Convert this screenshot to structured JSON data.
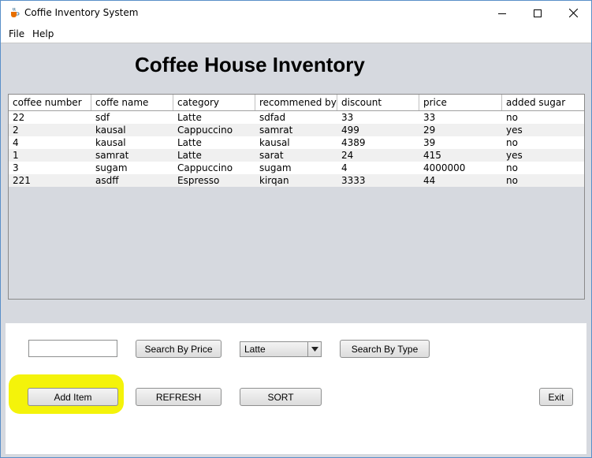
{
  "window": {
    "title": "Coffie Inventory System",
    "controls": [
      "minimize-icon",
      "maximize-icon",
      "close-icon"
    ],
    "icon": "java-cup-icon"
  },
  "menu": {
    "items": [
      {
        "label": "File"
      },
      {
        "label": "Help"
      }
    ]
  },
  "heading": "Coffee House Inventory",
  "table": {
    "columns": [
      "coffee number",
      "coffe name",
      "category",
      "recommened by",
      "discount",
      "price",
      "added sugar"
    ],
    "rows": [
      [
        "22",
        "sdf",
        "Latte",
        "sdfad",
        "33",
        "33",
        "no"
      ],
      [
        "2",
        "kausal",
        "Cappuccino",
        "samrat",
        "499",
        "29",
        "yes"
      ],
      [
        "4",
        "kausal",
        "Latte",
        "kausal",
        "4389",
        "39",
        "no"
      ],
      [
        "1",
        "samrat",
        "Latte",
        "sarat",
        "24",
        "415",
        "yes"
      ],
      [
        "3",
        "sugam",
        "Cappuccino",
        "sugam",
        "4",
        "4000000",
        "no"
      ],
      [
        "221",
        "asdff",
        "Espresso",
        "kirqan",
        "3333",
        "44",
        "no"
      ]
    ]
  },
  "controls": {
    "search_value": "",
    "search_by_price_label": "Search By Price",
    "category_selected": "Latte",
    "search_by_type_label": "Search By Type",
    "add_item_label": "Add Item",
    "refresh_label": "REFRESH",
    "sort_label": "SORT",
    "exit_label": "Exit"
  },
  "colors": {
    "highlight": "#f4f30a",
    "frame_border": "#5a8fc8"
  }
}
